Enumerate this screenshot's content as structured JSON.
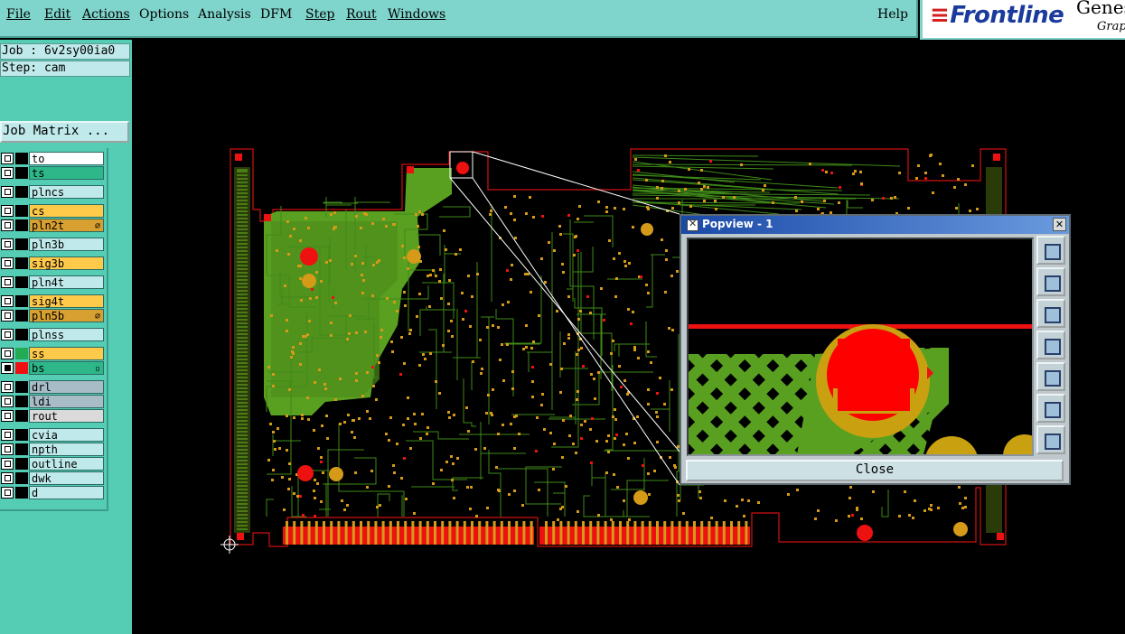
{
  "menu": {
    "file": "File",
    "edit": "Edit",
    "actions": "Actions",
    "options": "Options",
    "analysis": "Analysis",
    "dfm": "DFM",
    "step": "Step",
    "rout": "Rout",
    "windows": "Windows",
    "help": "Help"
  },
  "brand": {
    "logo": "Frontline",
    "product": "Genesis",
    "subtitle": "Graphic"
  },
  "job": {
    "job_line": "Job : 6v2sy00ia0",
    "step_line": "Step: cam",
    "matrix_button": "Job Matrix ..."
  },
  "layers": [
    {
      "name": "to",
      "color": "#ffffff",
      "checked": false,
      "mark": ""
    },
    {
      "name": "ts",
      "color": "#2eb88a",
      "checked": false,
      "mark": ""
    },
    {
      "name": "plncs",
      "color": "#bfe9ea",
      "checked": false,
      "mark": ""
    },
    {
      "name": "cs",
      "color": "#ffc94a",
      "checked": false,
      "mark": ""
    },
    {
      "name": "pln2t",
      "color": "#d8a030",
      "checked": false,
      "mark": "⌀"
    },
    {
      "name": "pln3b",
      "color": "#bfe9ea",
      "checked": false,
      "mark": ""
    },
    {
      "name": "sig3b",
      "color": "#ffc94a",
      "checked": false,
      "mark": ""
    },
    {
      "name": "pln4t",
      "color": "#bfe9ea",
      "checked": false,
      "mark": ""
    },
    {
      "name": "sig4t",
      "color": "#ffc94a",
      "checked": false,
      "mark": ""
    },
    {
      "name": "pln5b",
      "color": "#d8a030",
      "checked": false,
      "mark": "⌀"
    },
    {
      "name": "plnss",
      "color": "#bfe9ea",
      "checked": false,
      "mark": ""
    },
    {
      "name": "ss",
      "color": "#ffc94a",
      "checked": false,
      "mark": ""
    },
    {
      "name": "bs",
      "color": "#2eb88a",
      "checked": true,
      "mark": "▫"
    },
    {
      "name": "drl",
      "color": "#a8bcc8",
      "checked": false,
      "mark": ""
    },
    {
      "name": "ldi",
      "color": "#a8bcc8",
      "checked": false,
      "mark": ""
    },
    {
      "name": "rout",
      "color": "#dadada",
      "checked": false,
      "mark": ""
    },
    {
      "name": "cvia",
      "color": "#bfe9ea",
      "checked": false,
      "mark": ""
    },
    {
      "name": "npth",
      "color": "#bfe9ea",
      "checked": false,
      "mark": ""
    },
    {
      "name": "outline",
      "color": "#bfe9ea",
      "checked": false,
      "mark": ""
    },
    {
      "name": "dwk",
      "color": "#bfe9ea",
      "checked": false,
      "mark": ""
    },
    {
      "name": "d",
      "color": "#bfe9ea",
      "checked": false,
      "mark": ""
    }
  ],
  "layer_swatches": {
    "ss": "#22aa55",
    "bs": "#ee1111"
  },
  "popview": {
    "title": "Popview - 1",
    "close_x": "✕",
    "close_button": "Close"
  },
  "colors": {
    "menu_bg": "#7fd4cc",
    "panel_bg": "#55cdb4",
    "copper_green": "#5aa020",
    "pad_red": "#ff1010",
    "pad_orange": "#d49a18",
    "board_outline": "#d01010"
  }
}
